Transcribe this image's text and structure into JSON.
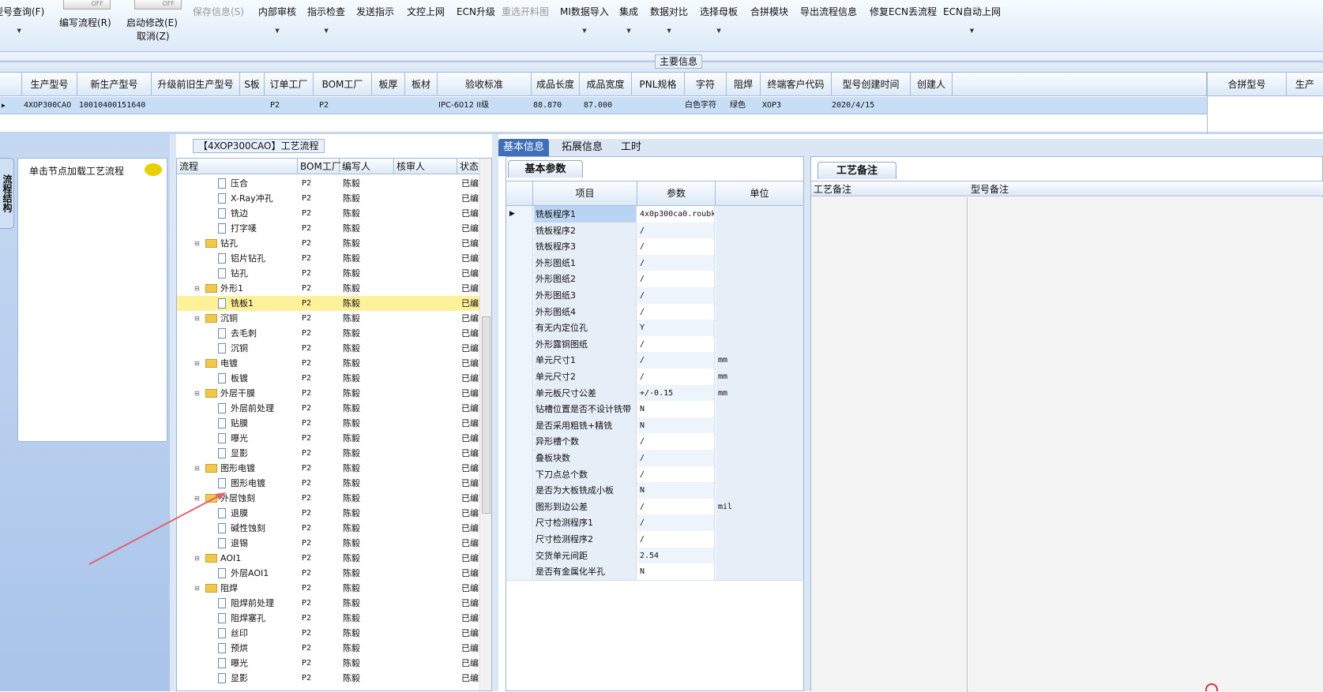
{
  "toolbar": {
    "items": [
      {
        "label": "型号查询(F)",
        "enabled": true,
        "dropdown": true
      },
      {
        "label": "编写流程(R)",
        "enabled": true,
        "dropdown": false,
        "toggle": "OFF"
      },
      {
        "label": "启动修改(E)",
        "enabled": true,
        "dropdown": false,
        "toggle": "OFF"
      },
      {
        "label": "取消(Z)",
        "enabled": true,
        "dropdown": false
      },
      {
        "label": "保存信息(S)",
        "enabled": false,
        "dropdown": false
      },
      {
        "label": "内部审核",
        "enabled": true,
        "dropdown": true
      },
      {
        "label": "指示检查",
        "enabled": true,
        "dropdown": true
      },
      {
        "label": "发送指示",
        "enabled": true,
        "dropdown": false
      },
      {
        "label": "文控上网",
        "enabled": true,
        "dropdown": false
      },
      {
        "label": "ECN升级",
        "enabled": true,
        "dropdown": false
      },
      {
        "label": "重选开料图",
        "enabled": false,
        "dropdown": false
      },
      {
        "label": "MI数据导入",
        "enabled": true,
        "dropdown": true
      },
      {
        "label": "集成",
        "enabled": true,
        "dropdown": true
      },
      {
        "label": "数据对比",
        "enabled": true,
        "dropdown": true
      },
      {
        "label": "选择母板",
        "enabled": true,
        "dropdown": true
      },
      {
        "label": "合拼模块",
        "enabled": true,
        "dropdown": false
      },
      {
        "label": "导出流程信息",
        "enabled": true,
        "dropdown": false
      },
      {
        "label": "修复ECN丢流程",
        "enabled": true,
        "dropdown": false
      },
      {
        "label": "ECN自动上网",
        "enabled": true,
        "dropdown": true
      }
    ]
  },
  "main_info": {
    "title": "主要信息",
    "columns": [
      "生产型号",
      "新生产型号",
      "升级前旧生产型号",
      "S板",
      "订单工厂",
      "BOM工厂",
      "板厚",
      "板材",
      "验收标准",
      "成品长度",
      "成品宽度",
      "PNL规格",
      "字符",
      "阻焊",
      "终端客户代码",
      "型号创建时间",
      "创建人"
    ],
    "row": [
      "4XOP300CAO",
      "10010400151640",
      "",
      "",
      "P2",
      "P2",
      "",
      "",
      "IPC-6012 II级",
      "88.870",
      "87.000",
      "",
      "白色字符",
      "绿色",
      "XOP3",
      "2020/4/15",
      ""
    ],
    "right_columns": [
      "合拼型号",
      "生产"
    ]
  },
  "left_panel": {
    "vertical_tab": "流程结构",
    "hint": "单击节点加载工艺流程"
  },
  "tree": {
    "title": "【4XOP300CAO】工艺流程",
    "columns": [
      "流程",
      "BOM工厂",
      "编写人",
      "核审人",
      "状态"
    ],
    "rows": [
      {
        "level": 2,
        "name": "压合",
        "bom": "P2",
        "writer": "陈毅",
        "status": "已编写"
      },
      {
        "level": 2,
        "name": "X-Ray冲孔",
        "bom": "P2",
        "writer": "陈毅",
        "status": "已编写"
      },
      {
        "level": 2,
        "name": "铣边",
        "bom": "P2",
        "writer": "陈毅",
        "status": "已编写"
      },
      {
        "level": 2,
        "name": "打字唛",
        "bom": "P2",
        "writer": "陈毅",
        "status": "已编写"
      },
      {
        "level": 1,
        "name": "钻孔",
        "bom": "P2",
        "writer": "陈毅",
        "status": "已编写"
      },
      {
        "level": 2,
        "name": "铝片钻孔",
        "bom": "P2",
        "writer": "陈毅",
        "status": "已编写"
      },
      {
        "level": 2,
        "name": "钻孔",
        "bom": "P2",
        "writer": "陈毅",
        "status": "已编写"
      },
      {
        "level": 1,
        "name": "外形1",
        "bom": "P2",
        "writer": "陈毅",
        "status": "已编写"
      },
      {
        "level": 2,
        "name": "铣板1",
        "bom": "P2",
        "writer": "陈毅",
        "status": "已编写",
        "selected": true
      },
      {
        "level": 1,
        "name": "沉铜",
        "bom": "P2",
        "writer": "陈毅",
        "status": "已编写"
      },
      {
        "level": 2,
        "name": "去毛刺",
        "bom": "P2",
        "writer": "陈毅",
        "status": "已编写"
      },
      {
        "level": 2,
        "name": "沉铜",
        "bom": "P2",
        "writer": "陈毅",
        "status": "已编写"
      },
      {
        "level": 1,
        "name": "电镀",
        "bom": "P2",
        "writer": "陈毅",
        "status": "已编写"
      },
      {
        "level": 2,
        "name": "板镀",
        "bom": "P2",
        "writer": "陈毅",
        "status": "已编写"
      },
      {
        "level": 1,
        "name": "外层干膜",
        "bom": "P2",
        "writer": "陈毅",
        "status": "已编写"
      },
      {
        "level": 2,
        "name": "外层前处理",
        "bom": "P2",
        "writer": "陈毅",
        "status": "已编写"
      },
      {
        "level": 2,
        "name": "贴膜",
        "bom": "P2",
        "writer": "陈毅",
        "status": "已编写"
      },
      {
        "level": 2,
        "name": "曝光",
        "bom": "P2",
        "writer": "陈毅",
        "status": "已编写"
      },
      {
        "level": 2,
        "name": "显影",
        "bom": "P2",
        "writer": "陈毅",
        "status": "已编写"
      },
      {
        "level": 1,
        "name": "图形电镀",
        "bom": "P2",
        "writer": "陈毅",
        "status": "已编写"
      },
      {
        "level": 2,
        "name": "图形电镀",
        "bom": "P2",
        "writer": "陈毅",
        "status": "已编写"
      },
      {
        "level": 1,
        "name": "外层蚀刻",
        "bom": "P2",
        "writer": "陈毅",
        "status": "已编写"
      },
      {
        "level": 2,
        "name": "退膜",
        "bom": "P2",
        "writer": "陈毅",
        "status": "已编写"
      },
      {
        "level": 2,
        "name": "碱性蚀刻",
        "bom": "P2",
        "writer": "陈毅",
        "status": "已编写"
      },
      {
        "level": 2,
        "name": "退锡",
        "bom": "P2",
        "writer": "陈毅",
        "status": "已编写"
      },
      {
        "level": 1,
        "name": "AOI1",
        "bom": "P2",
        "writer": "陈毅",
        "status": "已编写"
      },
      {
        "level": 2,
        "name": "外层AOI1",
        "bom": "P2",
        "writer": "陈毅",
        "status": "已编写"
      },
      {
        "level": 1,
        "name": "阻焊",
        "bom": "P2",
        "writer": "陈毅",
        "status": "已编写"
      },
      {
        "level": 2,
        "name": "阻焊前处理",
        "bom": "P2",
        "writer": "陈毅",
        "status": "已编写"
      },
      {
        "level": 2,
        "name": "阻焊塞孔",
        "bom": "P2",
        "writer": "陈毅",
        "status": "已编写"
      },
      {
        "level": 2,
        "name": "丝印",
        "bom": "P2",
        "writer": "陈毅",
        "status": "已编写"
      },
      {
        "level": 2,
        "name": "预烘",
        "bom": "P2",
        "writer": "陈毅",
        "status": "已编写"
      },
      {
        "level": 2,
        "name": "曝光",
        "bom": "P2",
        "writer": "陈毅",
        "status": "已编写"
      },
      {
        "level": 2,
        "name": "显影",
        "bom": "P2",
        "writer": "陈毅",
        "status": "已编写"
      }
    ]
  },
  "tabs": [
    "基本信息",
    "拓展信息",
    "工时"
  ],
  "basic": {
    "tab_label": "基本参数",
    "columns": [
      "项目",
      "参数",
      "单位"
    ],
    "rows": [
      {
        "item": "铣板程序1",
        "param": "4x0p300ca0.roubk",
        "unit": ""
      },
      {
        "item": "铣板程序2",
        "param": "/",
        "unit": ""
      },
      {
        "item": "铣板程序3",
        "param": "/",
        "unit": ""
      },
      {
        "item": "外形图纸1",
        "param": "/",
        "unit": ""
      },
      {
        "item": "外形图纸2",
        "param": "/",
        "unit": ""
      },
      {
        "item": "外形图纸3",
        "param": "/",
        "unit": ""
      },
      {
        "item": "外形图纸4",
        "param": "/",
        "unit": ""
      },
      {
        "item": "有无内定位孔",
        "param": "Y",
        "unit": ""
      },
      {
        "item": "外形露铜图纸",
        "param": "/",
        "unit": ""
      },
      {
        "item": "单元尺寸1",
        "param": "/",
        "unit": "mm"
      },
      {
        "item": "单元尺寸2",
        "param": "/",
        "unit": "mm"
      },
      {
        "item": "单元板尺寸公差",
        "param": "+/-0.15",
        "unit": "mm"
      },
      {
        "item": "钻槽位置是否不设计铣带",
        "param": "N",
        "unit": ""
      },
      {
        "item": "是否采用粗铣+精铣",
        "param": "N",
        "unit": ""
      },
      {
        "item": "异形槽个数",
        "param": "/",
        "unit": ""
      },
      {
        "item": "叠板块数",
        "param": "/",
        "unit": ""
      },
      {
        "item": "下刀点总个数",
        "param": "/",
        "unit": ""
      },
      {
        "item": "是否为大板铣成小板",
        "param": "N",
        "unit": ""
      },
      {
        "item": "图形到边公差",
        "param": "/",
        "unit": "mil"
      },
      {
        "item": "尺寸检测程序1",
        "param": "/",
        "unit": ""
      },
      {
        "item": "尺寸检测程序2",
        "param": "/",
        "unit": ""
      },
      {
        "item": "交货单元间距",
        "param": "2.54",
        "unit": ""
      },
      {
        "item": "是否有金属化半孔",
        "param": "N",
        "unit": ""
      }
    ]
  },
  "notes": {
    "tab_label": "工艺备注",
    "columns": [
      "工艺备注",
      "型号备注"
    ]
  }
}
